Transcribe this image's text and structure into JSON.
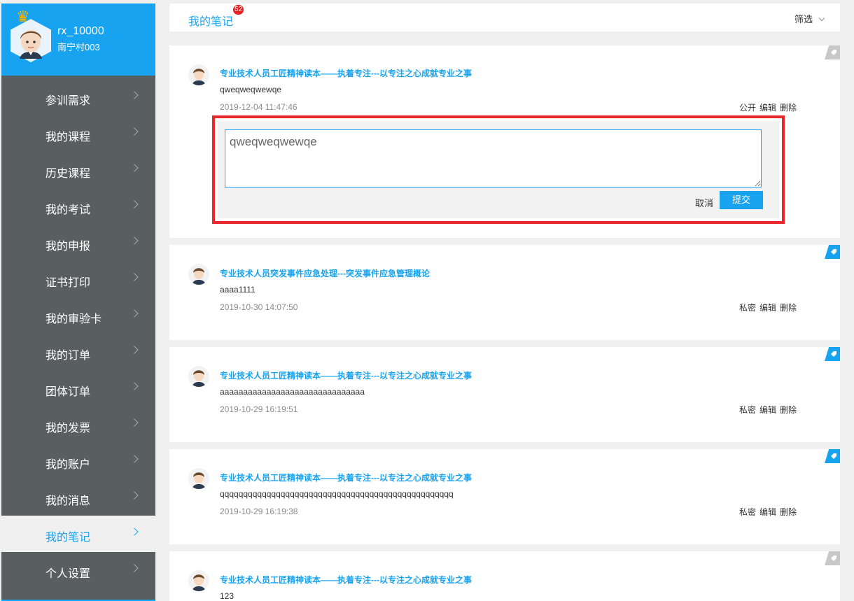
{
  "sidebar": {
    "user_name": "rx_10000",
    "user_org": "南宁村003",
    "menu": [
      {
        "label": "参训需求"
      },
      {
        "label": "我的课程"
      },
      {
        "label": "历史课程"
      },
      {
        "label": "我的考试"
      },
      {
        "label": "我的申报"
      },
      {
        "label": "证书打印"
      },
      {
        "label": "我的审验卡"
      },
      {
        "label": "我的订单"
      },
      {
        "label": "团体订单"
      },
      {
        "label": "我的发票"
      },
      {
        "label": "我的账户"
      },
      {
        "label": "我的消息"
      },
      {
        "label": "我的笔记"
      },
      {
        "label": "个人设置"
      }
    ],
    "active_index": 12
  },
  "header": {
    "title": "我的笔记",
    "badge": "52",
    "filter_label": "筛选"
  },
  "notes": [
    {
      "title": "专业技术人员工匠精神读本——执着专注---以专注之心成就专业之事",
      "content": "qweqweqwewqe",
      "time": "2019-12-04 11:47:46",
      "visibility": "公开",
      "edit": "编辑",
      "delete": "删除",
      "corner_color": "#c8c8c8"
    },
    {
      "title": "专业技术人员突发事件应急处理---突发事件应急管理概论",
      "content": "aaaa1111",
      "time": "2019-10-30 14:07:50",
      "visibility": "私密",
      "edit": "编辑",
      "delete": "删除",
      "corner_color": "#17a3f0"
    },
    {
      "title": "专业技术人员工匠精神读本——执着专注---以专注之心成就专业之事",
      "content": "aaaaaaaaaaaaaaaaaaaaaaaaaaaaaaa",
      "time": "2019-10-29 16:19:51",
      "visibility": "私密",
      "edit": "编辑",
      "delete": "删除",
      "corner_color": "#17a3f0"
    },
    {
      "title": "专业技术人员工匠精神读本——执着专注---以专注之心成就专业之事",
      "content": "qqqqqqqqqqqqqqqqqqqqqqqqqqqqqqqqqqqqqqqqqqqqqqqqqq",
      "time": "2019-10-29 16:19:38",
      "visibility": "私密",
      "edit": "编辑",
      "delete": "删除",
      "corner_color": "#17a3f0"
    },
    {
      "title": "专业技术人员工匠精神读本——执着专注---以专注之心成就专业之事",
      "content": "123",
      "corner_color": "#c8c8c8"
    }
  ],
  "editor": {
    "value": "qweqweqwewqe",
    "cancel_label": "取消",
    "submit_label": "提交"
  },
  "colors": {
    "accent": "#17a3f0",
    "sidebar_bg": "#595f60",
    "highlight": "#e8282d"
  },
  "icons": {
    "crown": "crown-icon",
    "chevron": "chevron-right-icon",
    "filter_chevron": "chevron-down-icon",
    "note_tag": "tag-icon"
  }
}
